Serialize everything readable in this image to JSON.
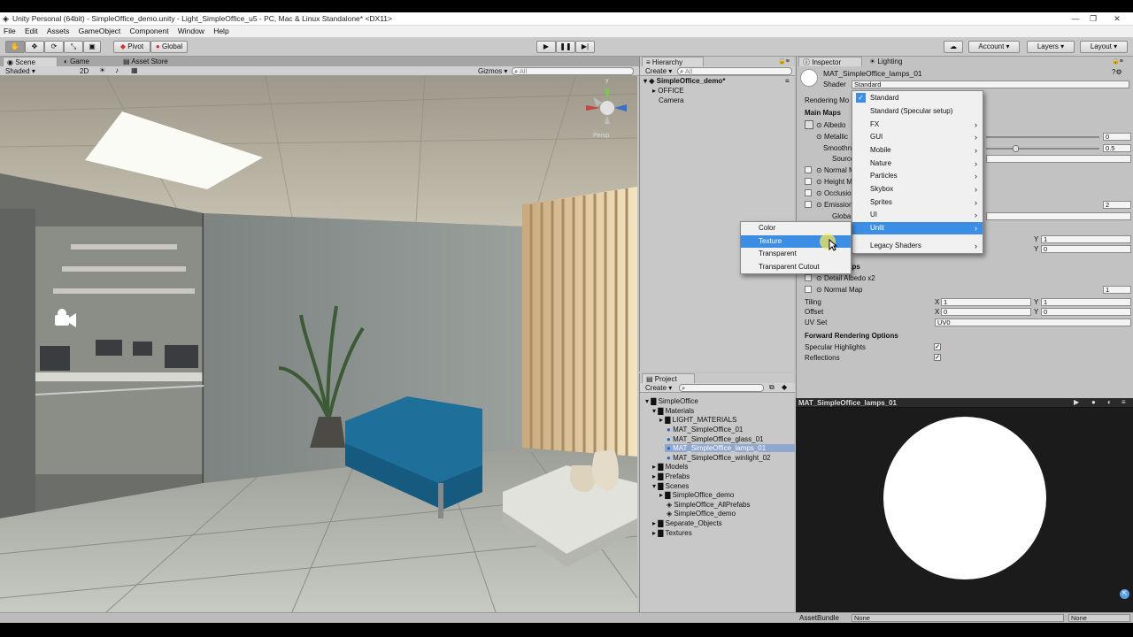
{
  "window": {
    "title": "Unity Personal (64bit) - SimpleOffice_demo.unity - Light_SimpleOffice_u5 - PC, Mac & Linux Standalone* <DX11>"
  },
  "menu": [
    "File",
    "Edit",
    "Assets",
    "GameObject",
    "Component",
    "Window",
    "Help"
  ],
  "toolbar": {
    "pivot": "Pivot",
    "global": "Global",
    "account": "Account",
    "layers": "Layers",
    "layout": "Layout"
  },
  "scene_tabs": {
    "scene": "Scene",
    "game": "Game",
    "asset_store": "Asset Store"
  },
  "scene_toolbar": {
    "shading": "Shaded",
    "mode2d": "2D",
    "gizmos": "Gizmos",
    "search": "All"
  },
  "scene_gizmo": {
    "y": "y",
    "persp": "Persp"
  },
  "hierarchy": {
    "tab": "Hierarchy",
    "create": "Create",
    "search": "All",
    "scene": "SimpleOffice_demo*",
    "items": [
      "OFFICE",
      "Camera"
    ]
  },
  "project": {
    "tab": "Project",
    "create": "Create",
    "tree": [
      "SimpleOffice",
      "Materials",
      "LIGHT_MATERIALS",
      "MAT_SimpleOffice_01",
      "MAT_SimpleOffice_glass_01",
      "MAT_SimpleOffice_lamps_01",
      "MAT_SimpleOffice_winlight_02",
      "Models",
      "Prefabs",
      "Scenes",
      "SimpleOffice_demo",
      "SimpleOffice_AllPrefabs",
      "SimpleOffice_demo",
      "Separate_Objects",
      "Textures"
    ]
  },
  "inspector": {
    "tab": "Inspector",
    "lighting_tab": "Lighting",
    "material_name": "MAT_SimpleOffice_lamps_01",
    "shader_label": "Shader",
    "shader_value": "Standard",
    "rendering_mode": "Rendering Mo",
    "main_maps": "Main Maps",
    "albedo": "Albedo",
    "metallic": "Metallic",
    "metallic_value": "0",
    "smoothness": "Smoothn",
    "smoothness_value": "0.5",
    "source": "Source",
    "normal": "Normal M",
    "height": "Height M",
    "occlusion": "Occlusio",
    "emission": "Emission",
    "emission_value": "2",
    "global": "Globa",
    "tiling_y_top": "1",
    "offset_y_top": "0",
    "secondary_maps": "aps",
    "detail_albedo": "Detail Albedo x2",
    "normal_map": "Normal Map",
    "normal_map_value": "1",
    "tiling": "Tiling",
    "offset": "Offset",
    "tiling_x": "1",
    "tiling_y": "1",
    "offset_x": "0",
    "offset_y": "0",
    "uv_set": "UV Set",
    "uv_value": "UV0",
    "forward_options": "Forward Rendering Options",
    "specular": "Specular Highlights",
    "reflections": "Reflections",
    "x": "X",
    "y": "Y"
  },
  "shader_menu": {
    "items": [
      "Standard",
      "Standard (Specular setup)",
      "FX",
      "GUI",
      "Mobile",
      "Nature",
      "Particles",
      "Skybox",
      "Sprites",
      "UI",
      "Unlit",
      "Legacy Shaders"
    ],
    "selected": "Standard",
    "highlighted": "Unlit"
  },
  "unlit_submenu": {
    "items": [
      "Color",
      "Texture",
      "Transparent",
      "Transparent Cutout"
    ],
    "highlighted": "Texture"
  },
  "preview": {
    "title": "MAT_SimpleOffice_lamps_01"
  },
  "status": {
    "assetbundle": "AssetBundle",
    "none1": "None",
    "none2": "None"
  }
}
